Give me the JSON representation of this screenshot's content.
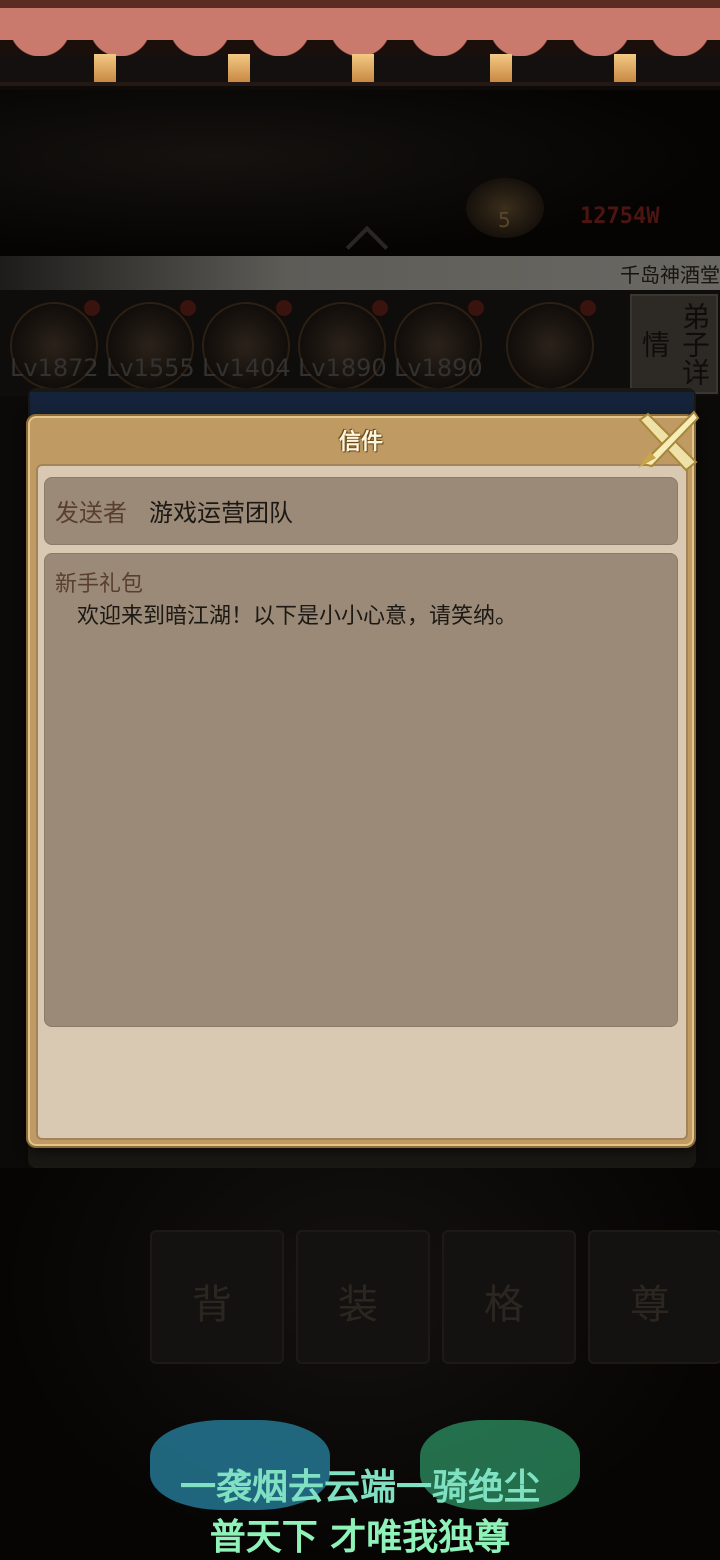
{
  "background": {
    "coin_value": "5",
    "power_value": "12754W",
    "location": "千岛神酒堂",
    "hero_levels": [
      "Lv1872",
      "Lv1555",
      "Lv1404",
      "Lv1890",
      "Lv1890"
    ],
    "detail_button": "弟子详情",
    "menu_tiles": [
      "背",
      "装",
      "格",
      "尊"
    ]
  },
  "dialog": {
    "title": "信件",
    "sender_label": "发送者",
    "sender_name": "游戏运营团队",
    "subject": "新手礼包",
    "body": "欢迎来到暗江湖！以下是小小心意，请笑纳。",
    "close_icon": "close-x-icon"
  },
  "slogan": {
    "line1": "一袭烟去云端一骑绝尘",
    "line2": "普天下 才唯我独尊"
  },
  "colors": {
    "dialog_frame": "#bf9a62",
    "dialog_inner": "#d9c9b3",
    "field_bg": "#9a8a77",
    "label_brown": "#5a3e30",
    "slogan_green": "#8ff2b8"
  }
}
